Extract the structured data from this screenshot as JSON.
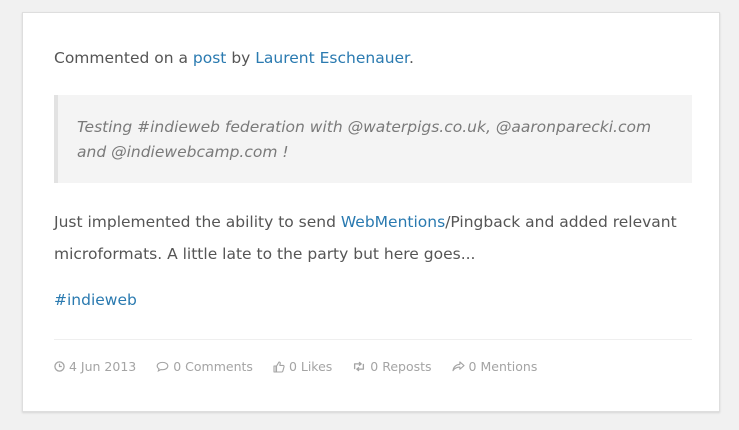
{
  "context": {
    "prefix": "Commented on a ",
    "post_link": "post",
    "by": " by ",
    "author_link": "Laurent Eschenauer",
    "suffix": "."
  },
  "quote": {
    "text": "Testing #indieweb federation with @waterpigs.co.uk, @aaronparecki.com and @indiewebcamp.com !"
  },
  "body": {
    "text_before": "Just implemented the ability to send ",
    "link": "WebMentions",
    "text_after": "/Pingback and added relevant microformats. A little late to the party but here goes..."
  },
  "tags": {
    "hash": "#",
    "tag": "indieweb"
  },
  "meta": {
    "date": "4 Jun 2013",
    "comments": "0 Comments",
    "likes": "0 Likes",
    "reposts": "0 Reposts",
    "mentions": "0 Mentions",
    "icons": [
      "clock-icon",
      "comment-icon",
      "thumbs-up-icon",
      "retweet-icon",
      "share-icon"
    ]
  },
  "colors": {
    "link": "#2a7ab0",
    "text": "#555555",
    "meta": "#a4a4a4"
  }
}
